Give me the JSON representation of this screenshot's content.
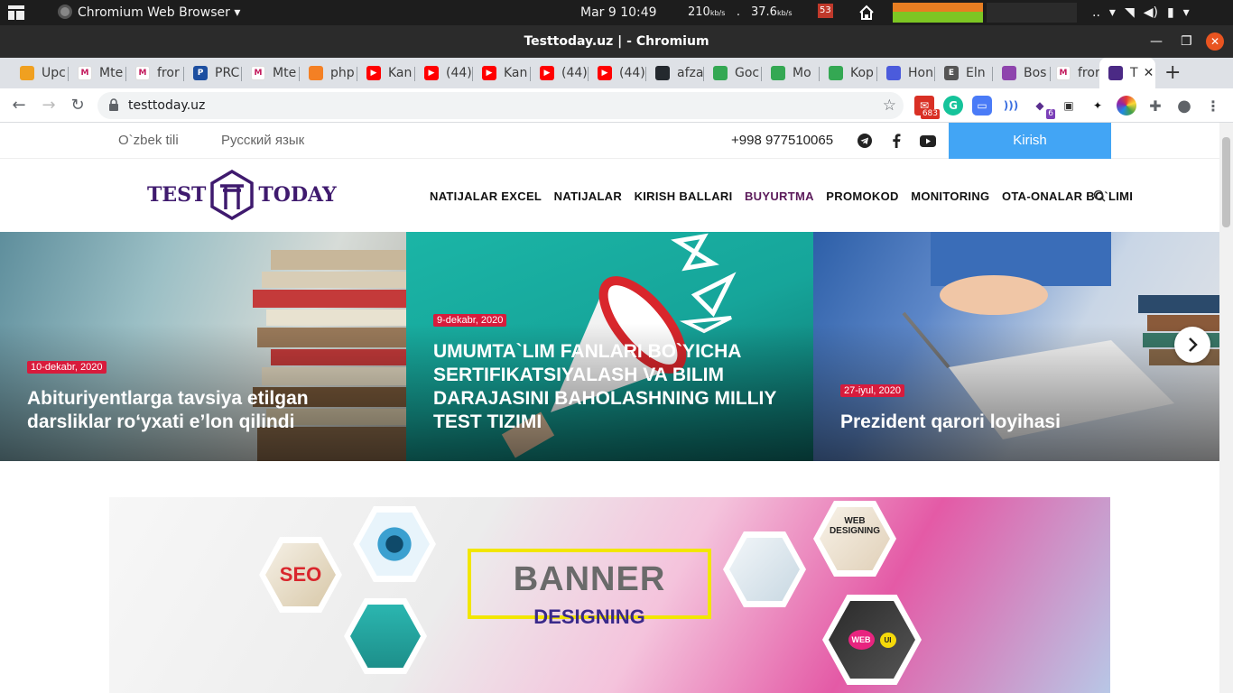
{
  "os_panel": {
    "app_name": "Chromium Web Browser",
    "clock": "Mar 9  10:49",
    "net_down": "210",
    "net_down_unit": "kb/s",
    "net_sep": ".",
    "net_up": "37.6",
    "net_up_unit": "kb/s",
    "badge": "53",
    "tray_dots": ".."
  },
  "window": {
    "title": "Testtoday.uz | - Chromium"
  },
  "tabs": [
    {
      "label": "Upc",
      "fav_color": "#f0a020",
      "fav_text": ""
    },
    {
      "label": "Mte",
      "fav_color": "#ffffff",
      "fav_text": "M"
    },
    {
      "label": "fror",
      "fav_color": "#ffffff",
      "fav_text": "M"
    },
    {
      "label": "PRC",
      "fav_color": "#1d4fa0",
      "fav_text": "P"
    },
    {
      "label": "Mte",
      "fav_color": "#ffffff",
      "fav_text": "M"
    },
    {
      "label": "php",
      "fav_color": "#f48024",
      "fav_text": ""
    },
    {
      "label": "Kan",
      "fav_color": "#ff0000",
      "fav_text": "▶"
    },
    {
      "label": "(44)",
      "fav_color": "#ff0000",
      "fav_text": "▶"
    },
    {
      "label": "Kan",
      "fav_color": "#ff0000",
      "fav_text": "▶"
    },
    {
      "label": "(44)",
      "fav_color": "#ff0000",
      "fav_text": "▶"
    },
    {
      "label": "(44)",
      "fav_color": "#ff0000",
      "fav_text": "▶"
    },
    {
      "label": "afza",
      "fav_color": "#24292e",
      "fav_text": ""
    },
    {
      "label": "Goc",
      "fav_color": "#34a853",
      "fav_text": ""
    },
    {
      "label": "Mo",
      "fav_color": "#34a853",
      "fav_text": ""
    },
    {
      "label": "Kop",
      "fav_color": "#34a853",
      "fav_text": ""
    },
    {
      "label": "Hon",
      "fav_color": "#4b5bdc",
      "fav_text": ""
    },
    {
      "label": "Eln",
      "fav_color": "#555555",
      "fav_text": "E"
    },
    {
      "label": "Bos",
      "fav_color": "#8e44ad",
      "fav_text": ""
    },
    {
      "label": "fror",
      "fav_color": "#ffffff",
      "fav_text": "M"
    },
    {
      "label": "T",
      "fav_color": "#4b2a85",
      "fav_text": "",
      "active": true
    }
  ],
  "toolbar": {
    "url": "testtoday.uz",
    "ext_badge_1": "683",
    "ext_badge_2": "6"
  },
  "site": {
    "lang_uz": "O`zbek tili",
    "lang_ru": "Русский язык",
    "phone": "+998 977510065",
    "login": "Kirish",
    "logo_left": "TEST",
    "logo_right": "TODAY",
    "nav": [
      "NATIJALAR EXCEL",
      "NATIJALAR",
      "KIRISH BALLARI",
      "BUYURTMA",
      "PROMOKOD",
      "MONITORING",
      "OTA-ONALAR BO`LIMI"
    ],
    "slides": [
      {
        "date": "10-dekabr, 2020",
        "title": "Abituriyentlarga tavsiya etilgan darsliklar ro‘yxati e’lon qilindi"
      },
      {
        "date": "9-dekabr, 2020",
        "title": "UMUMTA`LIM FANLARI BO`YICHA SERTIFIKATSIYALASH VA BILIM DARAJASINI BAHOLASHNING MILLIY TEST TIZIMI"
      },
      {
        "date": "27-iyul, 2020",
        "title": "Prezident qarori loyihasi"
      }
    ],
    "banner_big": "BANNER",
    "banner_small": "DESIGNING",
    "banner_hex_label_1": "SEO",
    "banner_hex_label_2": "WEB DESIGNING",
    "banner_hex_label_3": "WEB",
    "banner_hex_label_4": "UI"
  },
  "colors": {
    "login_bg": "#42a5f5",
    "date_badge": "#d81b3c",
    "logo": "#3f1a6e"
  }
}
